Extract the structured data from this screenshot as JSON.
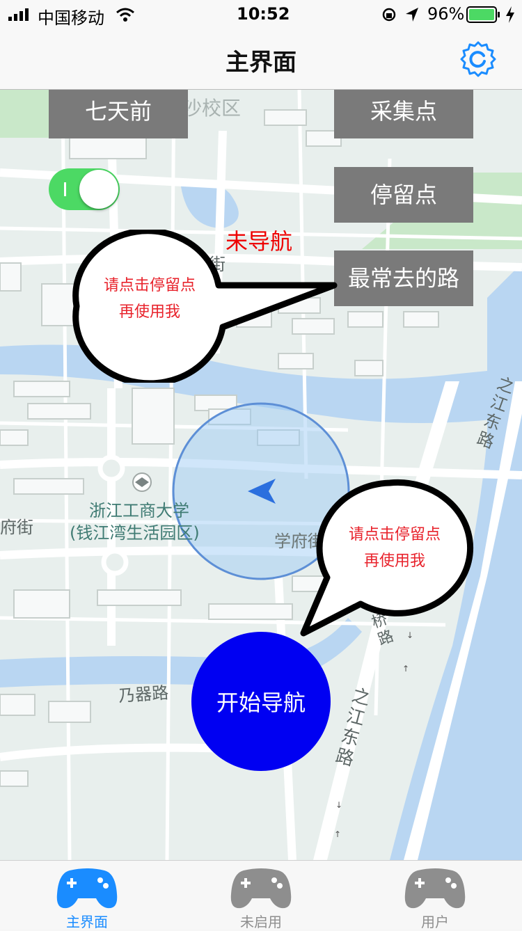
{
  "status_bar": {
    "carrier": "中国移动",
    "time": "10:52",
    "battery": "96%",
    "battery_color": "#4cd964"
  },
  "nav": {
    "title": "主界面",
    "right_icon": "settings-gear-icon",
    "accent_color": "#1a8cff"
  },
  "map": {
    "labels": {
      "campus_top": "沙校区",
      "street_xuelin": "学林街",
      "university_name": "浙江工商大学",
      "university_campus": "(钱江湾生活园区)",
      "street_left": "府街",
      "street_xuefu": "学府街",
      "road_zhijiang_top": "之江东路",
      "road_pingan": "平安桥路",
      "road_naiqi": "乃器路",
      "road_zhijiang_bottom": "之江东路"
    }
  },
  "controls": {
    "seven_days_ago": "七天前",
    "collection_points": "采集点",
    "stay_points": "停留点",
    "frequent_route": "最常去的路",
    "toggle_on": true,
    "nav_status": "未导航",
    "status_color": "#e00000"
  },
  "bubbles": {
    "top": {
      "line1": "请点击停留点",
      "line2": "再使用我"
    },
    "bottom": {
      "line1": "请点击停留点",
      "line2": "再使用我"
    }
  },
  "start_button": {
    "label": "开始导航",
    "color": "#0000f2"
  },
  "tab_bar": {
    "active_color": "#1a8cff",
    "inactive_color": "#8e8e8e",
    "tabs": [
      {
        "label": "主界面",
        "icon": "gamepad-icon",
        "active": true
      },
      {
        "label": "未启用",
        "icon": "gamepad-icon",
        "active": false
      },
      {
        "label": "用户",
        "icon": "gamepad-icon",
        "active": false
      }
    ]
  }
}
